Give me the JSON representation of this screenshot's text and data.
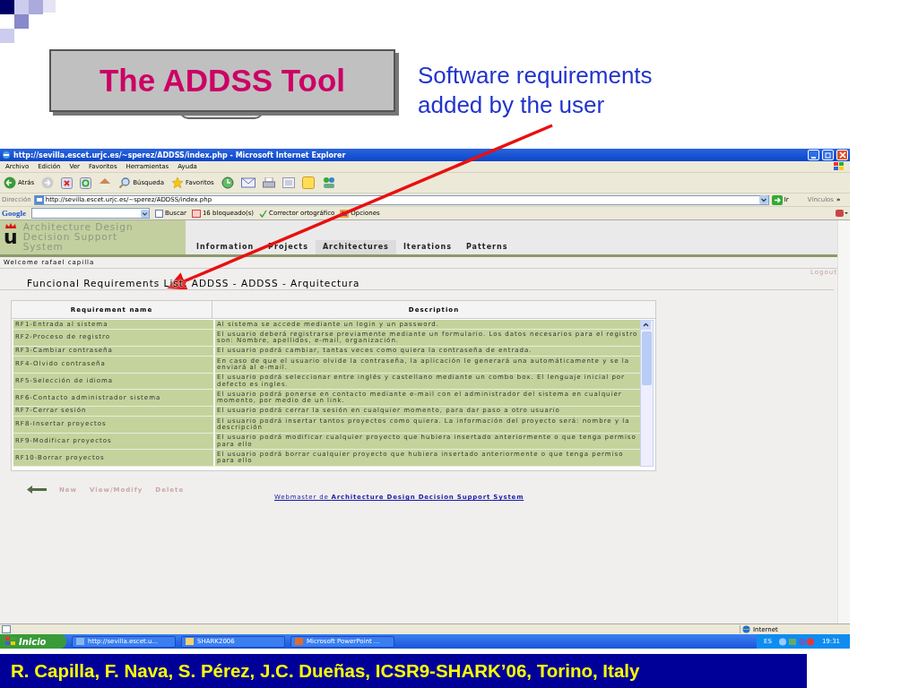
{
  "slide": {
    "title": "The ADDSS Tool",
    "annotation": "Software requirements added by the user",
    "footer": "R. Capilla, F. Nava, S. Pérez, J.C. Dueñas, ICSR9-SHARK’06, Torino, Italy"
  },
  "browser": {
    "title": "http://sevilla.escet.urjc.es/~sperez/ADDSS/index.php - Microsoft Internet Explorer",
    "menu": [
      "Archivo",
      "Edición",
      "Ver",
      "Favoritos",
      "Herramientas",
      "Ayuda"
    ],
    "toolbar": [
      {
        "kind": "back",
        "label": "Atrás"
      },
      {
        "kind": "forward"
      },
      {
        "kind": "stop"
      },
      {
        "kind": "refresh"
      },
      {
        "kind": "home"
      },
      {
        "kind": "search",
        "label": "Búsqueda"
      },
      {
        "kind": "favorites",
        "label": "Favoritos"
      },
      {
        "kind": "history"
      },
      {
        "kind": "mail"
      },
      {
        "kind": "print"
      },
      {
        "kind": "edit"
      },
      {
        "kind": "note"
      },
      {
        "kind": "messenger"
      }
    ],
    "address": {
      "label": "Dirección",
      "value": "http://sevilla.escet.urjc.es/~sperez/ADDSS/index.php",
      "go": "Ir",
      "links": "Vínculos",
      "more": "»"
    },
    "google_bar": {
      "logo": "Google",
      "search": "Buscar",
      "blocked": "16 bloqueado(s)",
      "spelling": "Corrector ortográfico",
      "options": "Opciones"
    },
    "page": {
      "logo_letter": "u",
      "site_title": [
        "Architecture Design",
        "Decision Support",
        "System"
      ],
      "nav": [
        {
          "label": "Information",
          "selected": false
        },
        {
          "label": "Projects",
          "selected": false
        },
        {
          "label": "Architectures",
          "selected": true
        },
        {
          "label": "Iterations",
          "selected": false
        },
        {
          "label": "Patterns",
          "selected": false
        }
      ],
      "welcome": "Welcome rafael capilla",
      "logout": "Logout",
      "heading": "Funcional Requirements List: ADDSS - ADDSS - Arquitectura",
      "table": {
        "columns": [
          "Requirement name",
          "Description"
        ],
        "rows": [
          {
            "name": "RF1-Entrada al sistema",
            "description": "Al sistema se accede mediante un login y un password."
          },
          {
            "name": "RF2-Proceso de registro",
            "description": "El usuario deberá registrarse previamente mediante un formulario. Los datos necesarios para el registro son: Nombre, apellidos, e-mail, organización."
          },
          {
            "name": "RF3-Cambiar contraseña",
            "description": "El usuario podrá cambiar, tantas veces como quiera la contraseña de entrada."
          },
          {
            "name": "RF4-Olvido contraseña",
            "description": "En caso de que el usuario olvide la contraseña, la aplicación le generará una automáticamente y se la enviará al e-mail."
          },
          {
            "name": "RF5-Selección de idioma",
            "description": "El usuario podrá seleccionar entre inglés y castellano mediante un combo box. El lenguaje inicial por defecto es ingles."
          },
          {
            "name": "RF6-Contacto administrador sistema",
            "description": "El usuario podrá ponerse en contacto mediante e-mail con el administrador del sistema en cualquier momento, por medio de un link."
          },
          {
            "name": "RF7-Cerrar sesión",
            "description": "El usuario podrá cerrar la sesión en cualquier momento, para dar paso a otro usuario"
          },
          {
            "name": "RF8-Insertar proyectos",
            "description": "El usuario podrá insertar tantos proyectos como quiera. La información del proyecto será: nombre y la descripción"
          },
          {
            "name": "RF9-Modificar proyectos",
            "description": "El usuario podrá modificar cualquier proyecto que hubiera insertado anteriormente o que tenga permiso para ello"
          },
          {
            "name": "RF10-Borrar proyectos",
            "description": "El usuario podrá borrar cualquier proyecto que hubiera insertado anteriormente o que tenga permiso para ello"
          }
        ]
      },
      "actions": [
        "New",
        "View/Modify",
        "Delete"
      ],
      "footer_link": "Webmaster de **Architecture Design Decision Support System**"
    },
    "status": "Internet",
    "taskbar": {
      "start": "Inicio",
      "tasks": [
        "http://sevilla.escet.u...",
        "SHARK2006",
        "Microsoft PowerPoint ..."
      ],
      "language": "ES",
      "clock": "19:31"
    }
  }
}
